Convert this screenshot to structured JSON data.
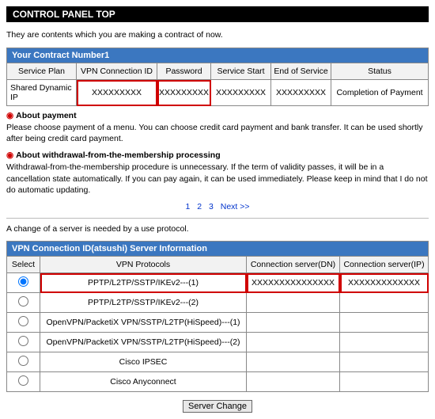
{
  "title": "CONTROL PANEL TOP",
  "intro": "They are contents which you are making a contract of now.",
  "contract": {
    "band": "Your Contract Number1",
    "headers": {
      "plan": "Service Plan",
      "vpnid": "VPN Connection ID",
      "password": "Password",
      "start": "Service Start",
      "end": "End of Service",
      "status": "Status"
    },
    "row": {
      "plan": "Shared Dynamic IP",
      "vpnid": "XXXXXXXXX",
      "password": "XXXXXXXXX",
      "start": "XXXXXXXXX",
      "end": "XXXXXXXXX",
      "status": "Completion of Payment"
    }
  },
  "sections": {
    "payment_title": "About payment",
    "payment_body": "Please choose payment of a menu. You can choose credit card payment and bank transfer. It can be used shortly after being credit card payment.",
    "withdraw_title": "About withdrawal-from-the-membership processing",
    "withdraw_body": "Withdrawal-from-the-membership procedure is unnecessary. If the term of validity passes, it will be in a cancellation state automatically. If you can pay again, it can be used immediately. Please keep in mind that I do not do automatic updating."
  },
  "pager": {
    "p1": "1",
    "p2": "2",
    "p3": "3",
    "next": "Next >>"
  },
  "change_note": "A change of a server is needed by a use protocol.",
  "server": {
    "band": "VPN Connection ID(atsushi) Server Information",
    "headers": {
      "select": "Select",
      "proto": "VPN Protocols",
      "dn": "Connection server(DN)",
      "ip": "Connection server(IP)"
    },
    "rows": [
      {
        "proto": "PPTP/L2TP/SSTP/IKEv2---(1)",
        "dn": "XXXXXXXXXXXXXXX",
        "ip": "XXXXXXXXXXXXX",
        "checked": true
      },
      {
        "proto": "PPTP/L2TP/SSTP/IKEv2---(2)",
        "dn": "",
        "ip": "",
        "checked": false
      },
      {
        "proto": "OpenVPN/PacketiX VPN/SSTP/L2TP(HiSpeed)---(1)",
        "dn": "",
        "ip": "",
        "checked": false
      },
      {
        "proto": "OpenVPN/PacketiX VPN/SSTP/L2TP(HiSpeed)---(2)",
        "dn": "",
        "ip": "",
        "checked": false
      },
      {
        "proto": "Cisco IPSEC",
        "dn": "",
        "ip": "",
        "checked": false
      },
      {
        "proto": "Cisco Anyconnect",
        "dn": "",
        "ip": "",
        "checked": false
      }
    ]
  },
  "button": "Server Change"
}
